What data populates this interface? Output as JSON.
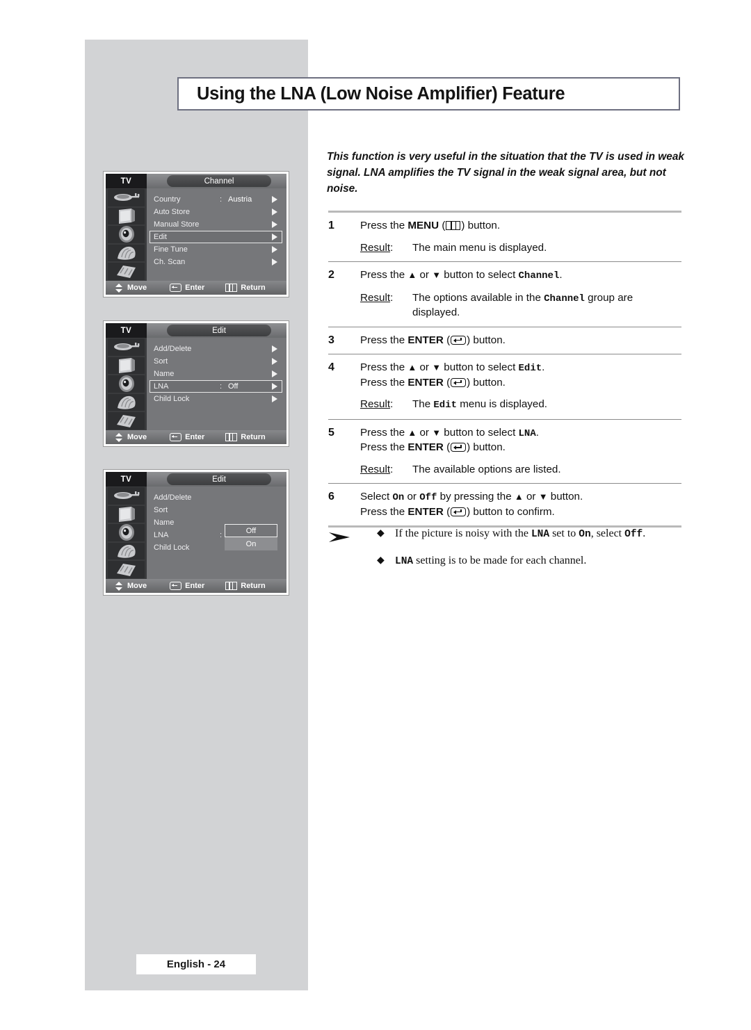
{
  "page": {
    "title": "Using the LNA (Low Noise Amplifier) Feature",
    "intro": "This function is very useful in the situation that the TV is used in weak signal. LNA amplifies the TV signal in the weak signal area, but not noise.",
    "footer": "English - 24"
  },
  "steps": [
    {
      "num": "1",
      "lines": [
        {
          "pre": "Press the ",
          "bold": "MENU",
          "mid": " (",
          "icon": "menu-icon",
          "post": ") button."
        }
      ],
      "result": {
        "label": "Result",
        "colon": ":",
        "text": "The main menu is displayed."
      }
    },
    {
      "num": "2",
      "lines": [
        {
          "pre": "Press the ",
          "up": "▲",
          "or": " or ",
          "down": "▼",
          "mid2": " button to select ",
          "mono": "Channel",
          "post": "."
        }
      ],
      "result": {
        "label": "Result",
        "colon": ":",
        "pre": "The options available in the ",
        "mono": "Channel",
        "post": " group are displayed."
      }
    },
    {
      "num": "3",
      "lines": [
        {
          "pre": "Press the ",
          "bold": "ENTER",
          "mid": " (",
          "icon": "enter-icon",
          "post": ") button."
        }
      ]
    },
    {
      "num": "4",
      "lines": [
        {
          "pre": "Press the ",
          "up": "▲",
          "or": " or ",
          "down": "▼",
          "mid2": " button to select ",
          "mono": "Edit",
          "post": "."
        },
        {
          "pre": "Press the ",
          "bold": "ENTER",
          "mid": " (",
          "icon": "enter-icon",
          "post": ") button."
        }
      ],
      "result": {
        "label": "Result",
        "colon": ":",
        "pre": "The ",
        "mono": "Edit",
        "post": " menu is displayed."
      }
    },
    {
      "num": "5",
      "lines": [
        {
          "pre": "Press the ",
          "up": "▲",
          "or": " or ",
          "down": "▼",
          "mid2": " button to select ",
          "mono": "LNA",
          "post": "."
        },
        {
          "pre": "Press the ",
          "bold": "ENTER",
          "mid": " (",
          "icon": "enter-icon",
          "post": ") button."
        }
      ],
      "result": {
        "label": "Result",
        "colon": ":",
        "text": "The available options are listed."
      }
    },
    {
      "num": "6",
      "lines": [
        {
          "pre": "Select ",
          "mono": "On",
          "or": " or ",
          "mono2": "Off",
          "mid2": "  by pressing the ",
          "up": "▲",
          "or2": " or ",
          "down": "▼",
          "post": " button."
        },
        {
          "pre": "Press the ",
          "bold": "ENTER",
          "mid": " (",
          "icon": "enter-icon",
          "post": ") button to confirm."
        }
      ]
    }
  ],
  "notes": {
    "arrow_icon": "note-arrow-icon",
    "bullet": "◆",
    "items": [
      {
        "pre": "If the picture is noisy with the ",
        "mono": "LNA",
        "mid": " set to ",
        "mono2": "On",
        "mid2": ", select ",
        "mono3": "Off",
        "post": "."
      },
      {
        "pre": "",
        "mono": "LNA",
        "mid": " setting is to be made for each channel.",
        "mono2": "",
        "mid2": "",
        "mono3": "",
        "post": ""
      }
    ]
  },
  "osd_menus": [
    {
      "tv_label": "TV",
      "title": "Channel",
      "icons": [
        "antenna-icon",
        "tv-set-icon",
        "speaker-icon",
        "hand-icon",
        "film-icon"
      ],
      "rows": [
        {
          "label": "Country",
          "colon": ":",
          "value": "Austria",
          "arrow": true,
          "selected": false
        },
        {
          "label": "Auto Store",
          "colon": "",
          "value": "",
          "arrow": true,
          "selected": false
        },
        {
          "label": "Manual Store",
          "colon": "",
          "value": "",
          "arrow": true,
          "selected": false
        },
        {
          "label": "Edit",
          "colon": "",
          "value": "",
          "arrow": true,
          "selected": true
        },
        {
          "label": "Fine Tune",
          "colon": "",
          "value": "",
          "arrow": true,
          "selected": false
        },
        {
          "label": "Ch. Scan",
          "colon": "",
          "value": "",
          "arrow": true,
          "selected": false
        }
      ],
      "bottom": {
        "move": "Move",
        "enter": "Enter",
        "return": "Return"
      },
      "dropdown": null
    },
    {
      "tv_label": "TV",
      "title": "Edit",
      "icons": [
        "antenna-icon",
        "tv-set-icon",
        "speaker-icon",
        "hand-icon",
        "film-icon"
      ],
      "rows": [
        {
          "label": "Add/Delete",
          "colon": "",
          "value": "",
          "arrow": true,
          "selected": false
        },
        {
          "label": "Sort",
          "colon": "",
          "value": "",
          "arrow": true,
          "selected": false
        },
        {
          "label": "Name",
          "colon": "",
          "value": "",
          "arrow": true,
          "selected": false
        },
        {
          "label": "LNA",
          "colon": ":",
          "value": "Off",
          "arrow": true,
          "selected": true
        },
        {
          "label": "Child Lock",
          "colon": "",
          "value": "",
          "arrow": true,
          "selected": false
        }
      ],
      "bottom": {
        "move": "Move",
        "enter": "Enter",
        "return": "Return"
      },
      "dropdown": null
    },
    {
      "tv_label": "TV",
      "title": "Edit",
      "icons": [
        "antenna-icon",
        "tv-set-icon",
        "speaker-icon",
        "hand-icon",
        "film-icon"
      ],
      "rows": [
        {
          "label": "Add/Delete",
          "colon": "",
          "value": "",
          "arrow": false,
          "selected": false
        },
        {
          "label": "Sort",
          "colon": "",
          "value": "",
          "arrow": false,
          "selected": false
        },
        {
          "label": "Name",
          "colon": "",
          "value": "",
          "arrow": false,
          "selected": false
        },
        {
          "label": "LNA",
          "colon": ":",
          "value": "",
          "arrow": false,
          "selected": false
        },
        {
          "label": "Child Lock",
          "colon": "",
          "value": "",
          "arrow": false,
          "selected": false
        }
      ],
      "bottom": {
        "move": "Move",
        "enter": "Enter",
        "return": "Return"
      },
      "dropdown": {
        "options": [
          "Off",
          "On"
        ],
        "selected_index": 0
      }
    }
  ]
}
